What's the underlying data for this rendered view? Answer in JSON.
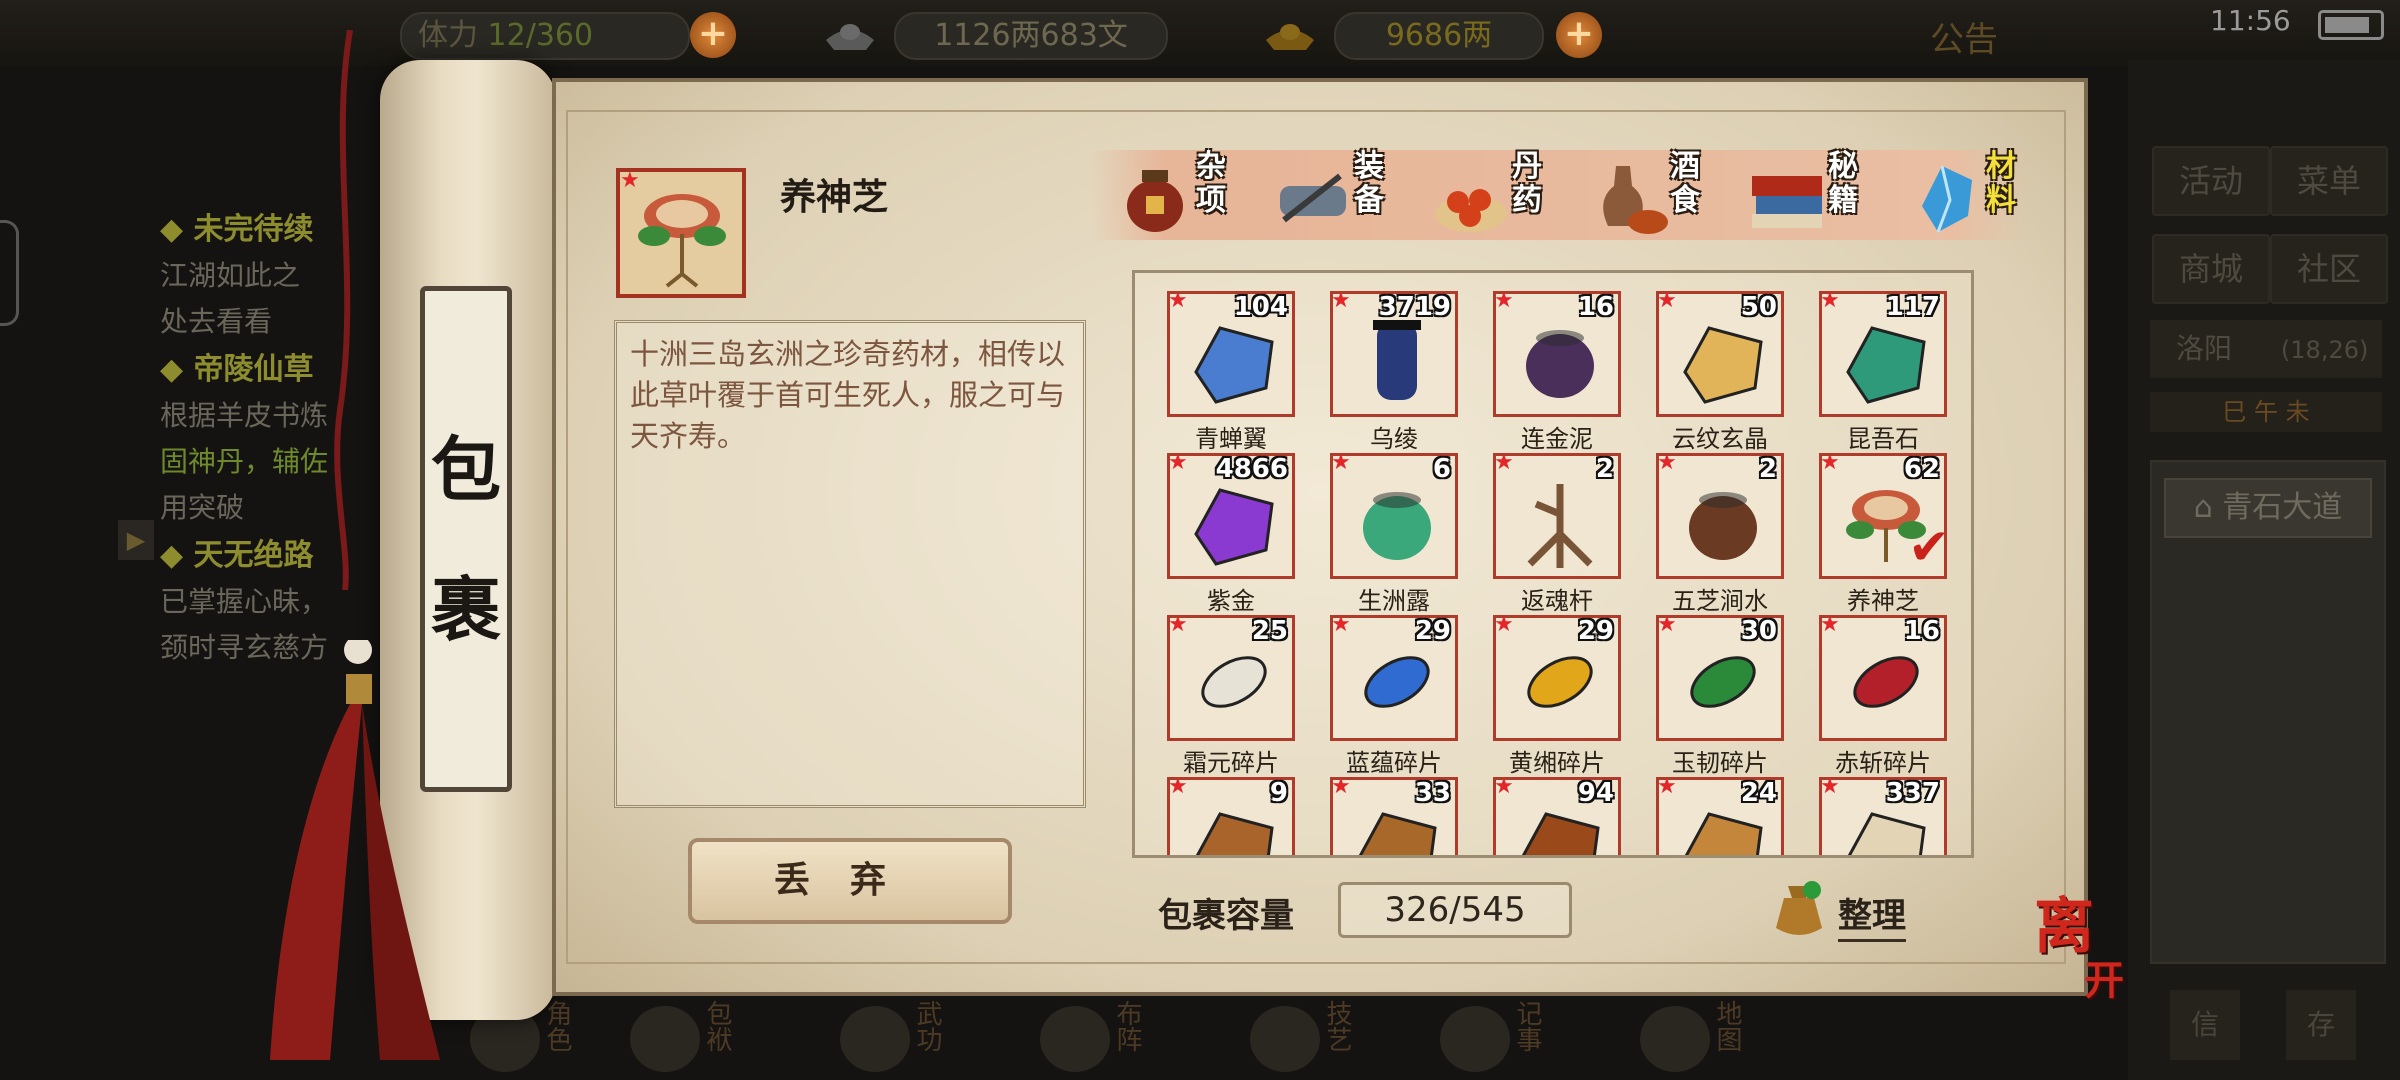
{
  "topbar": {
    "stamina_label": "体力",
    "stamina_value": "12/360",
    "money_value": "1126两683文",
    "gold_value": "9686两",
    "announce": "公告",
    "clock": "11:56"
  },
  "quest": {
    "items": [
      {
        "title": "未完待续",
        "lines": [
          "江湖如此之",
          "处去看看"
        ]
      },
      {
        "title": "帝陵仙草",
        "lines": [
          "根据羊皮书炼",
          "固神丹，辅佐",
          "用突破"
        ]
      },
      {
        "title": "天无绝路",
        "lines": [
          "已掌握心昧，",
          "颈时寻玄慈方"
        ]
      }
    ]
  },
  "right_panel": {
    "activity": "活动",
    "menu": "菜单",
    "shop": "商城",
    "community": "社区",
    "location": "洛阳",
    "coords": "(18,26)",
    "time_chars": "巳  午  未",
    "road": "青石大道",
    "bottom_left": "信",
    "bottom_right": "存"
  },
  "bottom_nav": [
    "角色",
    "包袱",
    "武功",
    "布阵",
    "技艺",
    "记事",
    "地图"
  ],
  "bag": {
    "title": "包裹",
    "selected": {
      "name": "养神芝",
      "description": "十洲三岛玄洲之珍奇药材，相传以此草叶覆于首可生死人，服之可与天齐寿。"
    },
    "discard_label": "丢弃",
    "capacity_label": "包裹容量",
    "capacity_value": "326/545",
    "sort_label": "整理",
    "leave_label_1": "离",
    "leave_label_2": "开",
    "tabs": [
      {
        "label": "杂项",
        "icon": "jar-icon"
      },
      {
        "label": "装备",
        "icon": "equipment-icon"
      },
      {
        "label": "丹药",
        "icon": "pills-icon"
      },
      {
        "label": "酒食",
        "icon": "wine-food-icon"
      },
      {
        "label": "秘籍",
        "icon": "book-icon"
      },
      {
        "label": "材料",
        "icon": "crystal-icon",
        "active": true
      }
    ],
    "items": [
      {
        "name": "青蝉翼",
        "count": "104",
        "icon": "blue-cloth-icon",
        "color": "#4a7ccf"
      },
      {
        "name": "乌绫",
        "count": "3719",
        "icon": "silk-spool-icon",
        "color": "#283a7a"
      },
      {
        "name": "连金泥",
        "count": "16",
        "icon": "clay-pot-icon",
        "color": "#4a2f5a"
      },
      {
        "name": "云纹玄晶",
        "count": "50",
        "icon": "gold-crystal-icon",
        "color": "#e2b45a"
      },
      {
        "name": "昆吾石",
        "count": "117",
        "icon": "jade-stone-icon",
        "color": "#2f9a7a"
      },
      {
        "name": "紫金",
        "count": "4866",
        "icon": "purple-ore-icon",
        "color": "#8a3ad0"
      },
      {
        "name": "生洲露",
        "count": "6",
        "icon": "green-vase-icon",
        "color": "#3aa87a"
      },
      {
        "name": "返魂杆",
        "count": "2",
        "icon": "root-icon",
        "color": "#7a5436"
      },
      {
        "name": "五芝涧水",
        "count": "2",
        "icon": "water-pot-icon",
        "color": "#6b3a22"
      },
      {
        "name": "养神芝",
        "count": "62",
        "icon": "lingzhi-icon",
        "color": "#c65a3a",
        "selected": true
      },
      {
        "name": "霜元碎片",
        "count": "25",
        "icon": "white-shard-icon",
        "color": "#e6e2d6"
      },
      {
        "name": "蓝蕴碎片",
        "count": "29",
        "icon": "blue-shard-icon",
        "color": "#2f6bd0"
      },
      {
        "name": "黄缃碎片",
        "count": "29",
        "icon": "yellow-shard-icon",
        "color": "#e2a61a"
      },
      {
        "name": "玉韧碎片",
        "count": "30",
        "icon": "green-shard-icon",
        "color": "#2a8a3a"
      },
      {
        "name": "赤斩碎片",
        "count": "16",
        "icon": "red-shard-icon",
        "color": "#b3202a"
      },
      {
        "name": "",
        "count": "9",
        "icon": "tiger-pelt-icon",
        "color": "#a8642a"
      },
      {
        "name": "",
        "count": "33",
        "icon": "snake-icon",
        "color": "#a8682a"
      },
      {
        "name": "",
        "count": "94",
        "icon": "leather-icon",
        "color": "#9a4a1a"
      },
      {
        "name": "",
        "count": "24",
        "icon": "hide-icon",
        "color": "#c4863a"
      },
      {
        "name": "",
        "count": "337",
        "icon": "skull-icon",
        "color": "#e2d4b4"
      }
    ]
  }
}
